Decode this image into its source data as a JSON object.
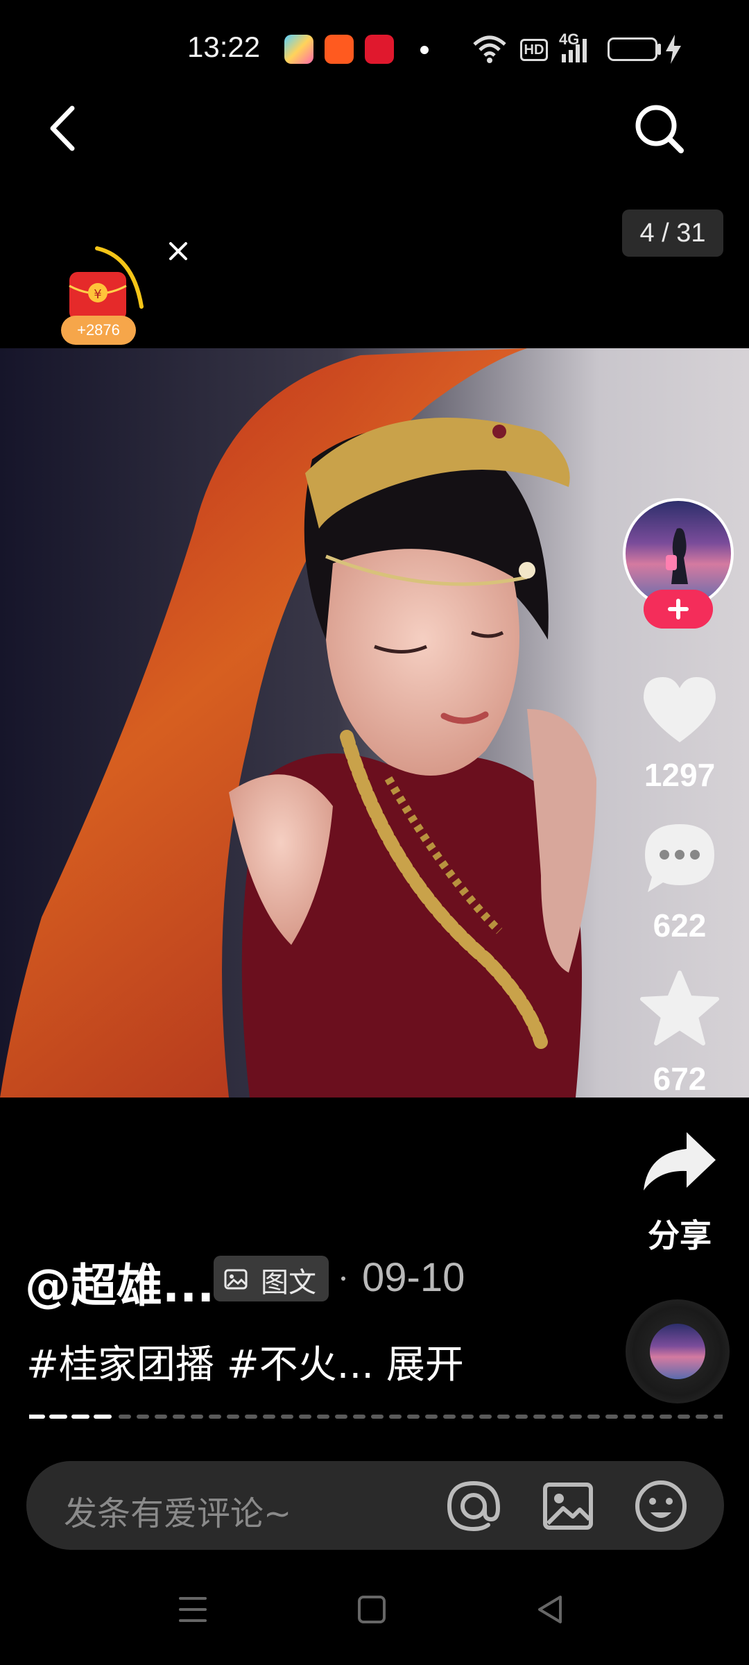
{
  "status_bar": {
    "time": "13:22",
    "hd": "HD",
    "net": "4G"
  },
  "header": {
    "back_icon": "chevron-left-icon",
    "search_icon": "search-icon",
    "page_counter": "4 / 31"
  },
  "red_packet": {
    "amount": "+2876",
    "close_icon": "close-icon"
  },
  "right_rail": {
    "likes": "1297",
    "comments": "622",
    "favorites": "672",
    "share_label": "分享"
  },
  "post": {
    "author": "@超雄...",
    "type_tag": "图文",
    "date": "09-10",
    "hashtags": "#桂家团播 #不火... 展开"
  },
  "comment_bar": {
    "placeholder": "发条有爱评论~"
  },
  "colors": {
    "accent_follow": "#f42d5a",
    "background": "#000000"
  }
}
